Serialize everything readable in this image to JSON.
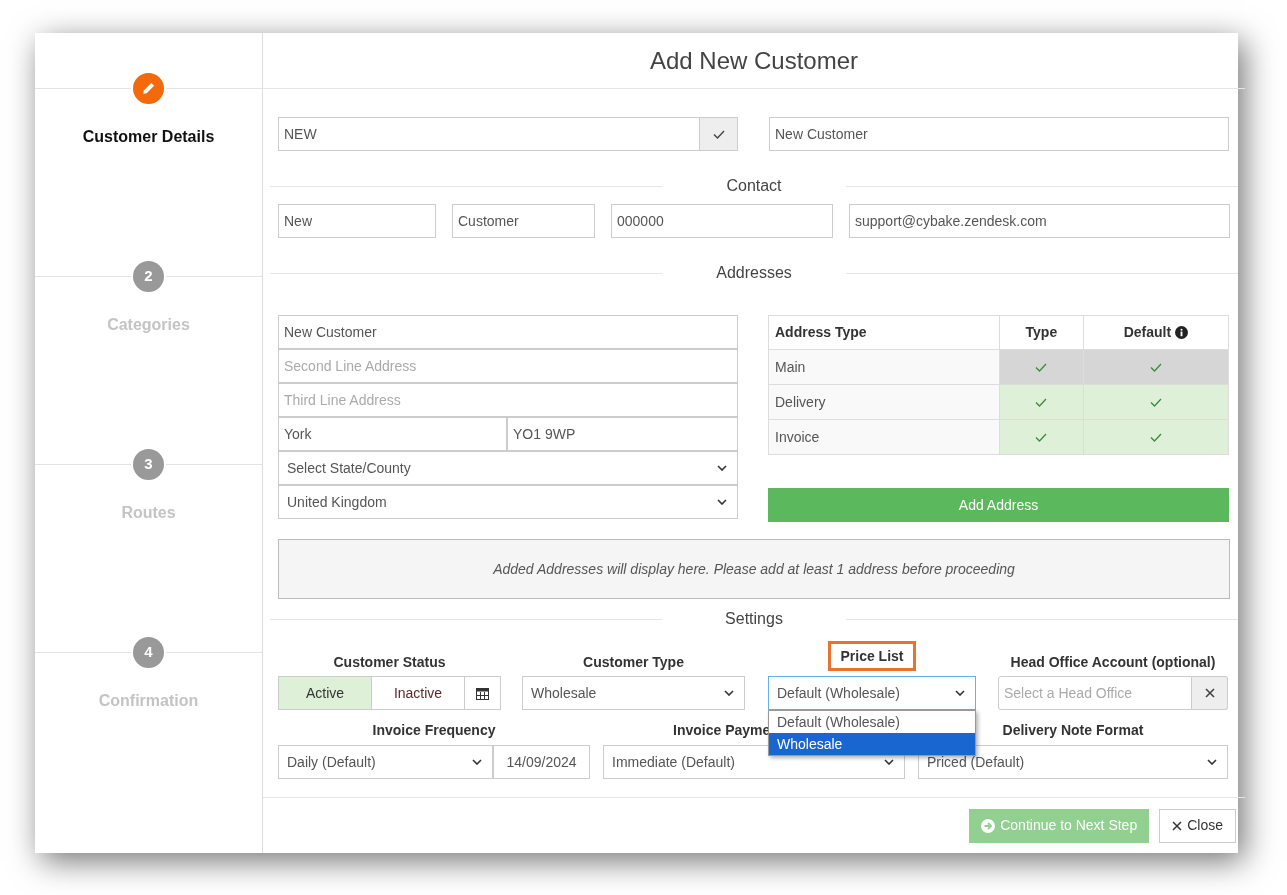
{
  "dialog": {
    "title": "Add New Customer"
  },
  "steps": [
    {
      "label": "Customer Details",
      "selected": true
    },
    {
      "number": "2",
      "label": "Categories",
      "selected": false
    },
    {
      "number": "3",
      "label": "Routes",
      "selected": false
    },
    {
      "number": "4",
      "label": "Confirmation",
      "selected": false
    }
  ],
  "account": {
    "code": "NEW",
    "name": "New Customer"
  },
  "contact": {
    "heading": "Contact",
    "fields": [
      "New",
      "Customer",
      "000000",
      "support@cybake.zendesk.com"
    ]
  },
  "addresses": {
    "heading": "Addresses",
    "line1": "New Customer",
    "line2_placeholder": "Second Line Address",
    "line3_placeholder": "Third Line Address",
    "city": "York",
    "postcode": "YO1 9WP",
    "state": "Select State/County",
    "country": "United Kingdom",
    "table": {
      "columns": [
        "Address Type",
        "Type",
        "Default"
      ],
      "rows": [
        {
          "name": "Main",
          "type_checked": true,
          "default_checked": true,
          "disabled": true
        },
        {
          "name": "Delivery",
          "type_checked": true,
          "default_checked": true,
          "disabled": false
        },
        {
          "name": "Invoice",
          "type_checked": true,
          "default_checked": true,
          "disabled": false
        }
      ]
    },
    "add_button": "Add Address",
    "empty_message": "Added Addresses will display here. Please add at least 1 address before proceeding"
  },
  "settings": {
    "heading": "Settings",
    "customer_status": {
      "label": "Customer Status",
      "options": [
        {
          "label": "Active",
          "selected": true
        },
        {
          "label": "Inactive",
          "selected": false
        }
      ]
    },
    "customer_type": {
      "label": "Customer Type",
      "value": "Wholesale"
    },
    "price_list": {
      "label": "Price List",
      "highlighted": true,
      "value": "Default (Wholesale)",
      "expanded": true,
      "options": [
        {
          "label": "Default (Wholesale)",
          "highlighted": false
        },
        {
          "label": "Wholesale",
          "highlighted": true
        }
      ]
    },
    "head_office": {
      "label": "Head Office Account (optional)",
      "placeholder": "Select a Head Office"
    },
    "invoice_frequency": {
      "label": "Invoice Frequency",
      "value": "Daily (Default)",
      "date": "14/09/2024"
    },
    "invoice_payment": {
      "label": "Invoice Payme",
      "value": "Immediate (Default)"
    },
    "delivery_note_format": {
      "label": "Delivery Note Format",
      "value": "Priced (Default)"
    }
  },
  "footer": {
    "continue": "Continue to Next Step",
    "close": "Close"
  }
}
